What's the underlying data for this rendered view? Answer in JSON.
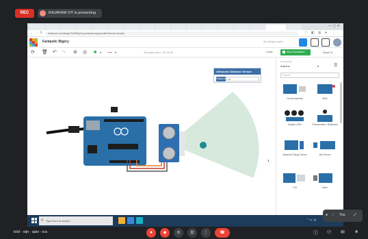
{
  "meet": {
    "rec_label": "REC",
    "presenting_label": "RAJARAM VIT is presenting",
    "meeting_code": "tctd - sijn - qaiv - ica",
    "you_label": "You"
  },
  "browser": {
    "url": "tinkercad.com/things/7e5iSi8qYnq-fantastic-bigery/editel?tenant=circuits"
  },
  "tinkercad": {
    "project_name": "Fantastic Bigery",
    "all_changes_saved": "All changes saved",
    "sim_time": "Simulator time: 00:00:35",
    "code_label": "Code",
    "stop_sim_label": "Stop Simulation",
    "send_to_label": "Send To"
  },
  "sensor_panel": {
    "title": "Ultrasonic Distance Sensor",
    "distance_label": "Distance",
    "distance_value": "in"
  },
  "components_panel": {
    "components_label": "Components",
    "category": "Arduino",
    "search_placeholder": "Search",
    "items": [
      {
        "caption": "Circuit Assembly"
      },
      {
        "caption": "Blink"
      },
      {
        "caption": "Multiple LEDs"
      },
      {
        "caption": "Potentiometer / Multimeter"
      },
      {
        "caption": "Ultrasonic Range Sensor"
      },
      {
        "caption": "Mini Sensor"
      },
      {
        "caption": "LCD"
      },
      {
        "caption": "Motor"
      }
    ]
  },
  "taskbar": {
    "search_placeholder": "Type here to search"
  },
  "colors": {
    "arduino": "#2a6fa8",
    "stop_button": "#2fae4f",
    "end_call": "#ea4335"
  }
}
